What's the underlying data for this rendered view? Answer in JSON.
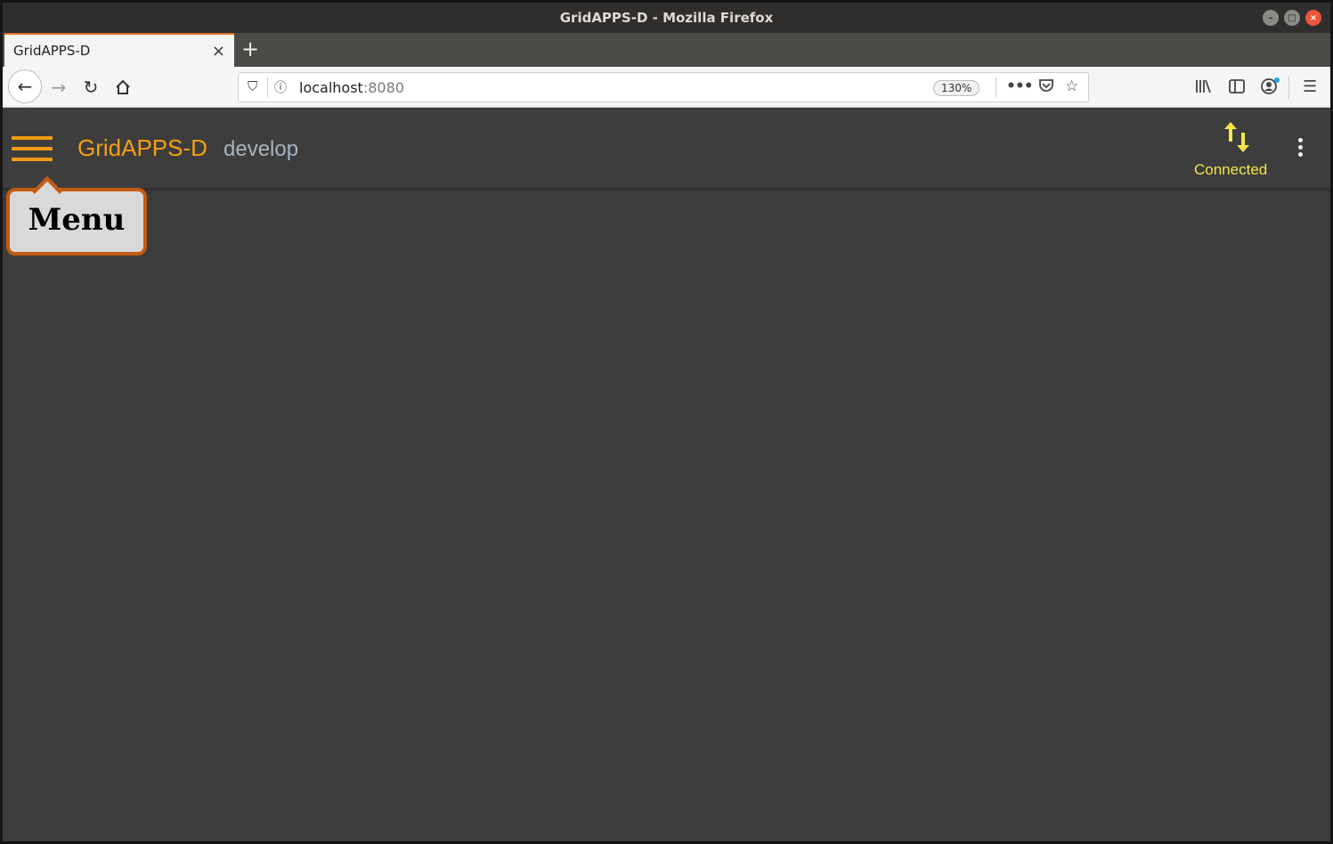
{
  "window": {
    "title": "GridAPPS-D - Mozilla Firefox"
  },
  "browser": {
    "tab": {
      "label": "GridAPPS-D",
      "close_glyph": "×"
    },
    "new_tab_glyph": "+",
    "url": {
      "host": "localhost",
      "port": ":8080"
    },
    "zoom": "130%"
  },
  "app": {
    "title": "GridAPPS-D",
    "subtitle": "develop",
    "status": {
      "label": "Connected",
      "color": "#f5e54a"
    }
  },
  "callout": {
    "text": "Menu"
  },
  "colors": {
    "accent": "#f59f14",
    "callout_border": "#c55a11",
    "background": "#3c3c3c"
  }
}
